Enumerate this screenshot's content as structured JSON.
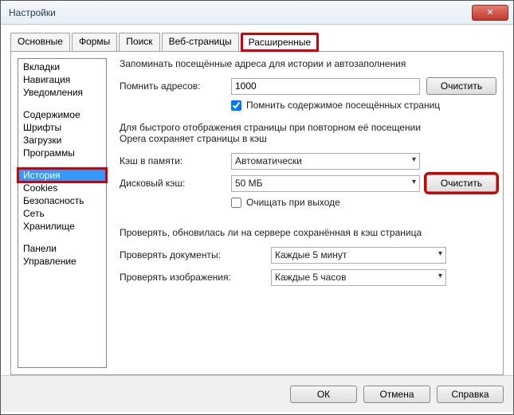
{
  "window": {
    "title": "Настройки"
  },
  "tabs": {
    "basic": "Основные",
    "forms": "Формы",
    "search": "Поиск",
    "webpages": "Веб-страницы",
    "advanced": "Расширенные"
  },
  "sidebar": {
    "vkladki": "Вкладки",
    "navigation": "Навигация",
    "notifications": "Уведомления",
    "content": "Содержимое",
    "fonts": "Шрифты",
    "downloads": "Загрузки",
    "programs": "Программы",
    "history": "История",
    "cookies": "Cookies",
    "security": "Безопасность",
    "network": "Сеть",
    "storage": "Хранилище",
    "panels": "Панели",
    "manage": "Управление"
  },
  "main": {
    "desc1": "Запоминать посещённые адреса для истории и автозаполнения",
    "remember_label": "Помнить адресов:",
    "remember_value": "1000",
    "clear1": "Очистить",
    "remember_content": "Помнить содержимое посещённых страниц",
    "cache_desc1": "Для быстрого отображения страницы при повторном её посещении",
    "cache_desc2": "Opera сохраняет страницы в кэш",
    "mem_cache_label": "Кэш в памяти:",
    "mem_cache_value": "Автоматически",
    "disk_cache_label": "Дисковый кэш:",
    "disk_cache_value": "50 МБ",
    "clear2": "Очистить",
    "clear_on_exit": "Очищать при выходе",
    "check_desc": "Проверять, обновилась ли на сервере сохранённая в кэш страница",
    "check_docs_label": "Проверять документы:",
    "check_docs_value": "Каждые 5 минут",
    "check_img_label": "Проверять изображения:",
    "check_img_value": "Каждые 5 часов"
  },
  "footer": {
    "ok": "ОК",
    "cancel": "Отмена",
    "help": "Справка"
  }
}
